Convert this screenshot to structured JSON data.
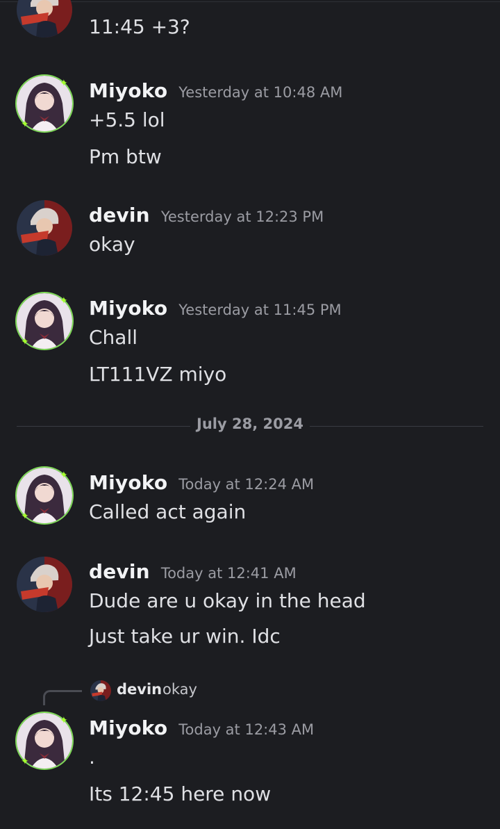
{
  "date_divider": "July 28, 2024",
  "messages": {
    "m0_text": "11:45 +3?",
    "m1": {
      "user": "Miyoko",
      "time": "Yesterday at 10:48 AM",
      "lines": [
        "+5.5 lol",
        "Pm btw"
      ]
    },
    "m2": {
      "user": "devin",
      "time": "Yesterday at 12:23 PM",
      "lines": [
        "okay"
      ]
    },
    "m3": {
      "user": "Miyoko",
      "time": "Yesterday at 11:45 PM",
      "lines": [
        "Chall",
        "LT111VZ miyo"
      ]
    },
    "m4": {
      "user": "Miyoko",
      "time": "Today at 12:24 AM",
      "lines": [
        "Called act again"
      ]
    },
    "m5": {
      "user": "devin",
      "time": "Today at 12:41 AM",
      "lines": [
        "Dude are u okay in the head",
        "Just take ur win. Idc"
      ]
    },
    "m6": {
      "reply": {
        "user": "devin",
        "text": "okay"
      },
      "user": "Miyoko",
      "time": "Today at 12:43 AM",
      "lines": [
        ".",
        "Its 12:45 here now"
      ]
    }
  },
  "colors": {
    "background": "#1c1d21",
    "accent_ring": "#7ed957",
    "timestamp": "#9b9ca3"
  },
  "icons": {
    "miyoko_avatar": "anime-girl-avatar",
    "devin_avatar": "anime-boy-avatar"
  }
}
